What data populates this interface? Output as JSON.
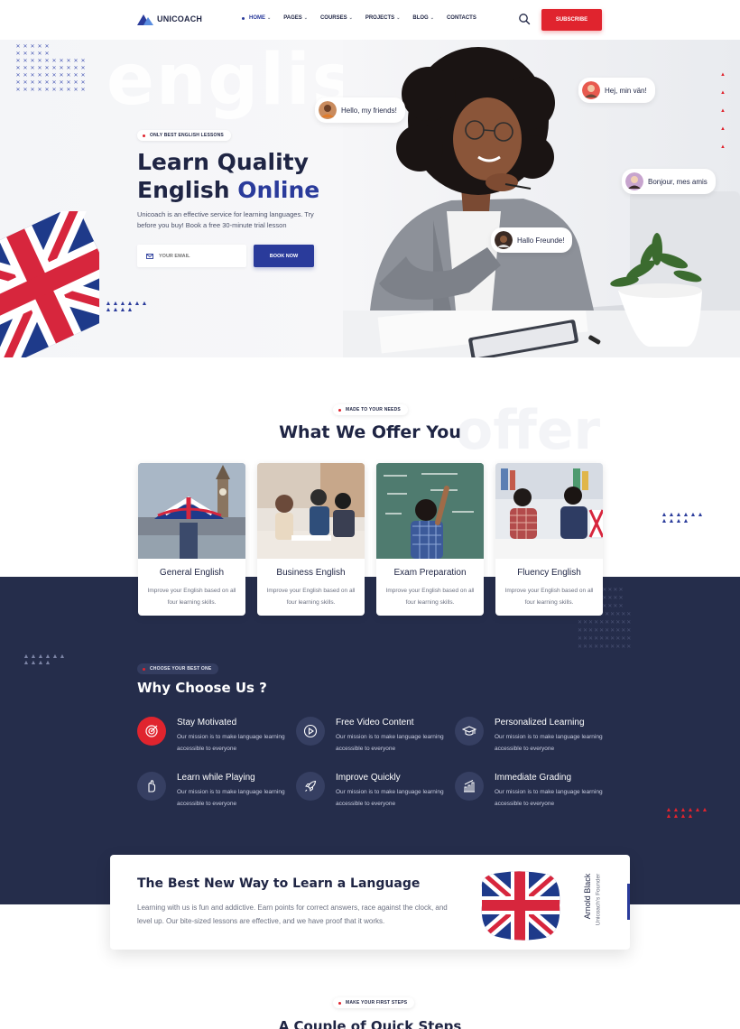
{
  "header": {
    "logo_text": "UNICOACH",
    "nav": [
      {
        "label": "HOME",
        "active": true,
        "dropdown": true
      },
      {
        "label": "PAGES",
        "active": false,
        "dropdown": true
      },
      {
        "label": "COURSES",
        "active": false,
        "dropdown": true
      },
      {
        "label": "PROJECTS",
        "active": false,
        "dropdown": true
      },
      {
        "label": "BLOG",
        "active": false,
        "dropdown": true
      },
      {
        "label": "CONTACTS",
        "active": false,
        "dropdown": false
      }
    ],
    "search_icon": "search-icon",
    "subscribe_label": "SUBSCRIBE"
  },
  "hero": {
    "background_word": "english",
    "badge": "ONLY BEST ENGLISH LESSONS",
    "title_line1": "Learn Quality",
    "title_line2_plain": "English ",
    "title_line2_accent": "Online",
    "description": "Unicoach is an effective service for learning languages. Try before you buy! Book a free 30-minute trial lesson",
    "email_placeholder": "YOUR EMAIL",
    "book_label": "BOOK NOW",
    "chats": [
      {
        "text": "Hello, my friends!"
      },
      {
        "text": "Hej, min vän!"
      },
      {
        "text": "Bonjour, mes amis"
      },
      {
        "text": "Hallo Freunde!"
      }
    ]
  },
  "offer": {
    "badge": "MADE TO YOUR NEEDS",
    "background_word": "offer",
    "title": "What We Offer You",
    "cards": [
      {
        "title": "General English",
        "desc": "Improve your English based on all four learning skills."
      },
      {
        "title": "Business English",
        "desc": "Improve your English based on all four learning skills."
      },
      {
        "title": "Exam Preparation",
        "desc": "Improve your English based on all four learning skills."
      },
      {
        "title": "Fluency English",
        "desc": "Improve your English based on all four learning skills."
      }
    ]
  },
  "why": {
    "badge": "CHOOSE YOUR BEST ONE",
    "title": "Why Choose Us ?",
    "features": [
      {
        "title": "Stay Motivated",
        "desc": "Our mission is to make language learning accessible to everyone",
        "icon": "target-icon"
      },
      {
        "title": "Free Video Content",
        "desc": "Our mission is to make language learning accessible to everyone",
        "icon": "play-icon"
      },
      {
        "title": "Personalized Learning",
        "desc": "Our mission is to make language learning accessible to everyone",
        "icon": "graduation-cap-icon"
      },
      {
        "title": "Learn while Playing",
        "desc": "Our mission is to make language learning accessible to everyone",
        "icon": "hand-icon"
      },
      {
        "title": "Improve Quickly",
        "desc": "Our mission is to make language learning accessible to everyone",
        "icon": "rocket-icon"
      },
      {
        "title": "Immediate Grading",
        "desc": "Our mission is to make language learning accessible to everyone",
        "icon": "chart-icon"
      }
    ]
  },
  "way": {
    "title": "The Best New Way to Learn a Language",
    "description": "Learning with us is fun and addictive. Earn points for correct answers, race against the clock, and level up. Our bite-sized lessons are effective, and we have proof that it works.",
    "founder_name": "Arnold Black",
    "founder_role": "Unicoach's Founder"
  },
  "steps": {
    "badge": "MAKE YOUR FIRST STEPS",
    "title": "A Couple of Quick Steps"
  },
  "colors": {
    "navy": "#252d4b",
    "brand_blue": "#2a3b9b",
    "red": "#e0242e",
    "text_dark": "#1f2544"
  }
}
